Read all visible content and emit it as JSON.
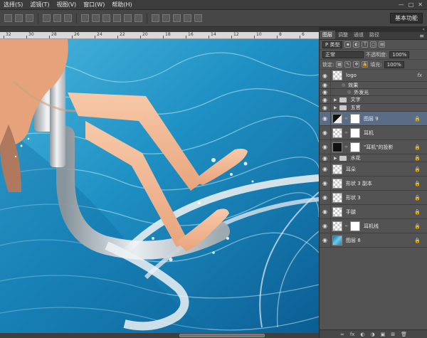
{
  "menu": {
    "items": [
      "选择(S)",
      "滤镜(T)",
      "视图(V)",
      "窗口(W)",
      "帮助(H)"
    ],
    "window_controls": [
      "—",
      "□",
      "✕"
    ]
  },
  "options": {
    "workspace_label": "基本功能"
  },
  "ruler": {
    "ticks": [
      "32",
      "30",
      "28",
      "26",
      "24",
      "22",
      "20",
      "18",
      "16",
      "14",
      "12",
      "10",
      "8",
      "6"
    ]
  },
  "panel": {
    "tabs": [
      "图层",
      "调整",
      "通道",
      "路径"
    ],
    "filter_label": "P 类型",
    "blend_mode": "正常",
    "opacity_label": "不透明度:",
    "opacity_value": "100%",
    "lock_label": "锁定:",
    "fill_label": "填充:",
    "fill_value": "100%",
    "bottom_icons": [
      "∞",
      "fx",
      "◐",
      "◑",
      "▣",
      "⊞",
      "🗑"
    ]
  },
  "layers": [
    {
      "name": "logo",
      "type": "layer",
      "thumb": "checker",
      "fx": "fx",
      "height": 17
    },
    {
      "name": "效果",
      "type": "effect-header",
      "height": 10
    },
    {
      "name": "外发光",
      "type": "effect",
      "height": 10
    },
    {
      "name": "文字",
      "type": "group",
      "height": 11
    },
    {
      "name": "五官",
      "type": "group",
      "height": 11
    },
    {
      "name": "图层 9",
      "type": "masked",
      "thumb": "half",
      "selected": true,
      "lock": true,
      "height": 20
    },
    {
      "name": "耳机",
      "type": "masked",
      "thumb": "checker",
      "lock": false,
      "height": 20
    },
    {
      "name": "\"耳机\"的投影",
      "type": "masked",
      "thumb": "black",
      "lock": true,
      "height": 20
    },
    {
      "name": "水花",
      "type": "group",
      "lock": true,
      "height": 11
    },
    {
      "name": "耳朵",
      "type": "layer",
      "thumb": "checker",
      "lock": true,
      "height": 20
    },
    {
      "name": "形状 3 副本",
      "type": "layer",
      "thumb": "checker",
      "lock": true,
      "height": 20
    },
    {
      "name": "形状 3",
      "type": "layer",
      "thumb": "checker",
      "lock": true,
      "height": 20
    },
    {
      "name": "手腿",
      "type": "layer",
      "thumb": "checker",
      "lock": true,
      "height": 20
    },
    {
      "name": "耳机线",
      "type": "masked",
      "thumb": "checker",
      "lock": true,
      "height": 20
    },
    {
      "name": "图层 8",
      "type": "layer",
      "thumb": "water",
      "lock": true,
      "height": 20
    }
  ]
}
